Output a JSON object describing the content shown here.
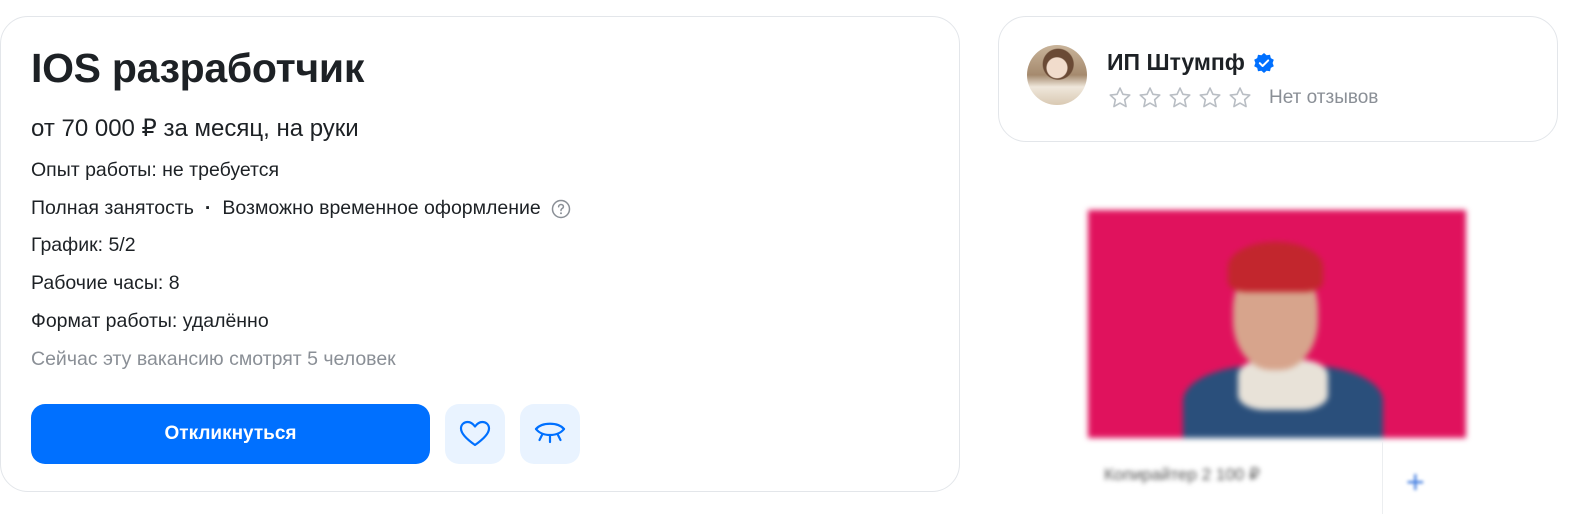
{
  "vacancy": {
    "title": "IOS разработчик",
    "salary": "от 70 000 ₽ за месяц, на руки",
    "experience": "Опыт работы: не требуется",
    "employment": "Полная занятость",
    "employment_extra": "Возможно временное оформление",
    "separator": "·",
    "schedule": "График: 5/2",
    "hours": "Рабочие часы: 8",
    "work_format": "Формат работы: удалённо",
    "viewers": "Сейчас эту вакансию смотрят 5 человек",
    "respond_label": "Откликнуться"
  },
  "company": {
    "name": "ИП Штумпф",
    "rating_stars": 0,
    "rating_max": 5,
    "reviews_text": "Нет отзывов"
  },
  "ad": {
    "caption": "Копирайтер 2 100 ₽",
    "plus_label": "+"
  },
  "colors": {
    "accent": "#0070ff",
    "icon_button_bg": "#e9f3ff",
    "muted_text": "#8a8f96",
    "ad_background": "#e0125d",
    "verified_badge": "#0070ff"
  },
  "icons": {
    "favorite": "heart-icon",
    "hide": "closed-eye-icon",
    "help": "question-circle-icon",
    "verified": "verified-badge-icon",
    "star": "star-outline-icon"
  }
}
